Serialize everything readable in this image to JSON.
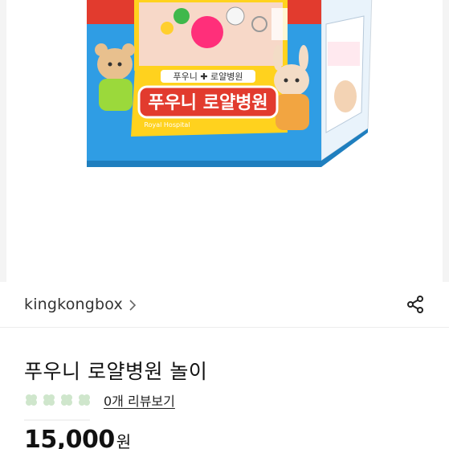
{
  "product_image": {
    "box_label_small": "푸우니 ✚ 로얄병원",
    "box_label_large": "푸우니 로얄병원",
    "box_label_english": "Royal Hospital"
  },
  "seller": {
    "name": "kingkongbox"
  },
  "product": {
    "title": "푸우니 로얄병원 놀이",
    "review_link": "0개 리뷰보기",
    "rating_icons": [
      "clover-icon",
      "clover-icon",
      "clover-icon",
      "clover-icon"
    ],
    "price": "15,000",
    "price_unit": "원"
  },
  "colors": {
    "clover_inactive": "#cfe6cc",
    "text_primary": "#111111",
    "box_blue": "#2f9de4",
    "box_yellow": "#ffd21e"
  }
}
